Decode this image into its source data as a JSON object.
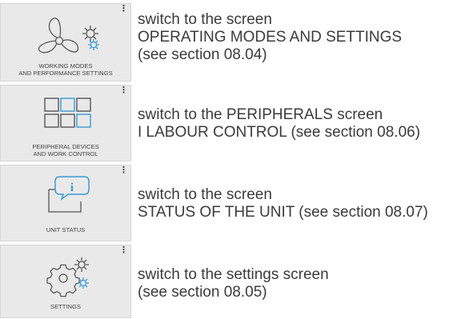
{
  "colors": {
    "accent_blue": "#3a9bd5",
    "icon_gray": "#555555",
    "tile_bg": "#e9e9e9"
  },
  "tiles": [
    {
      "icon": "fan-gear-icon",
      "label_lines": [
        "WORKING MODES",
        "AND PERFORMANCE SETTINGS"
      ],
      "description": [
        "switch to the screen",
        "OPERATING MODES AND SETTINGS",
        "(see section 08.04)"
      ]
    },
    {
      "icon": "peripherals-grid-icon",
      "label_lines": [
        "PERIPHERAL DEVICES",
        "AND WORK CONTROL"
      ],
      "description": [
        "switch to the PERIPHERALS screen",
        "I LABOUR CONTROL (see section 08.06)"
      ]
    },
    {
      "icon": "info-bubble-icon",
      "label_lines": [
        "UNIT STATUS"
      ],
      "description": [
        "switch to the screen",
        "STATUS OF THE UNIT (see section 08.07)"
      ]
    },
    {
      "icon": "settings-gears-icon",
      "label_lines": [
        "SETTINGS"
      ],
      "description": [
        "switch to the settings screen",
        "(see section 08.05)"
      ]
    }
  ]
}
